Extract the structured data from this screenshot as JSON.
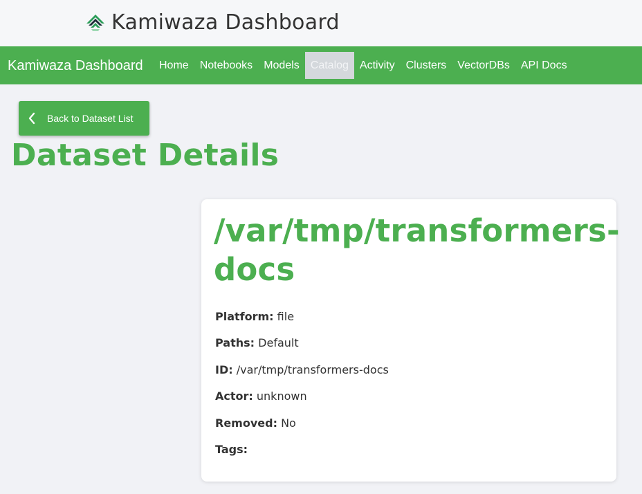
{
  "header": {
    "title": "Kamiwaza Dashboard",
    "logo_icon": "kamiwaza-logo-icon"
  },
  "navbar": {
    "brand": "Kamiwaza Dashboard",
    "links": [
      {
        "label": "Home"
      },
      {
        "label": "Notebooks"
      },
      {
        "label": "Models"
      },
      {
        "label": "Catalog",
        "active": true
      },
      {
        "label": "Activity"
      },
      {
        "label": "Clusters"
      },
      {
        "label": "VectorDBs"
      },
      {
        "label": "API Docs"
      }
    ]
  },
  "back_button": {
    "label": "Back to Dataset List",
    "icon": "chevron-left-icon"
  },
  "page_title": "Dataset Details",
  "dataset": {
    "name": "/var/tmp/transformers-docs",
    "fields": [
      {
        "key": "Platform:",
        "value": "file"
      },
      {
        "key": "Paths:",
        "value": "Default"
      },
      {
        "key": "ID:",
        "value": "/var/tmp/transformers-docs"
      },
      {
        "key": "Actor:",
        "value": "unknown"
      },
      {
        "key": "Removed:",
        "value": "No"
      },
      {
        "key": "Tags:",
        "value": ""
      }
    ]
  },
  "colors": {
    "accent": "#4caf50",
    "background": "#f1f2f6",
    "card": "#ffffff",
    "active_tab": "#d4d8dc"
  }
}
